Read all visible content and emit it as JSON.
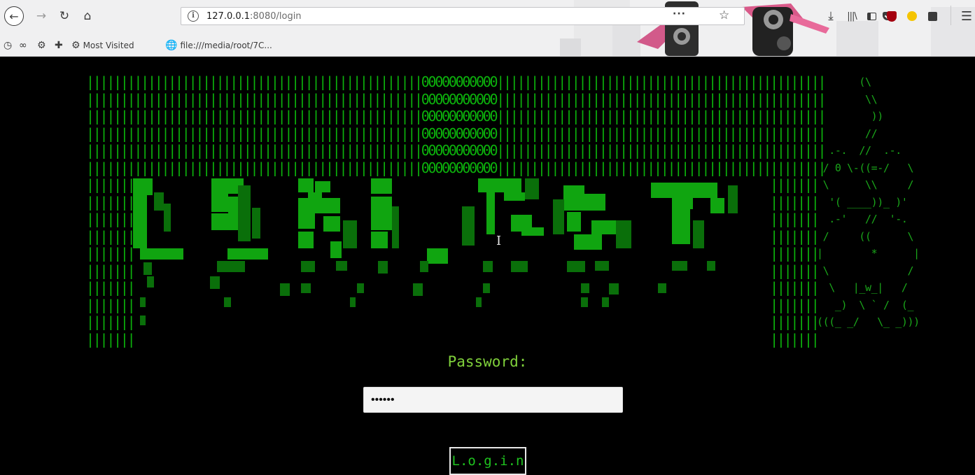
{
  "browser": {
    "url_host": "127.0.0.1",
    "url_rest": ":8080/login",
    "url_actions": "···",
    "bookmarks": [
      {
        "icon": "gear-icon",
        "label": "Most Visited"
      },
      {
        "icon": "globe-icon",
        "label": "file:///media/root/7C..."
      }
    ],
    "toolbar_icons": [
      "back-icon",
      "forward-icon",
      "reload-icon",
      "home-icon",
      "download-icon",
      "library-icon",
      "sidebar-icon",
      "ublock-icon",
      "emoji-icon",
      "note-icon",
      "menu-icon"
    ]
  },
  "page": {
    "banner_rows": [
      "|||||||||||||||||||||||||||||||||||||||||||||||||00000000000||||||||||||||||||||||||||||||||||||||||||||||||",
      "|||||||||||||||||||||||||||||||||||||||||||||||||00000000000||||||||||||||||||||||||||||||||||||||||||||||||",
      "|||||||||||||||||||||||||||||||||||||||||||||||||00000000000||||||||||||||||||||||||||||||||||||||||||||||||",
      "|||||||||||||||||||||||||||||||||||||||||||||||||00000000000||||||||||||||||||||||||||||||||||||||||||||||||",
      "|||||||||||||||||||||||||||||||||||||||||||||||||00000000000||||||||||||||||||||||||||||||||||||||||||||||||",
      "|||||||||||||||||||||||||||||||||||||||||||||||||00000000000||||||||||||||||||||||||||||||||||||||||||||||||",
      "|||||||                                                                                             |||||||",
      "|||||||                                                                                             |||||||",
      "|||||||                                                                                             |||||||",
      "|||||||                                                                                             |||||||",
      "|||||||                                                                                             |||||||",
      "|||||||                                                                                             |||||||",
      "|||||||                                                                                             |||||||",
      "|||||||                                                                                             |||||||",
      "|||||||                                                                                             |||||||",
      "|||||||                                                                                             |||||||"
    ],
    "raccoon_art": [
      "       (\\",
      "        \\\\",
      "         ))",
      "        //",
      "  .-.  //  .-.",
      " / 0 \\-((=-/   \\",
      " \\      \\\\     /",
      "  '( ____))_ )'",
      "  .-'   //  '-.",
      " /     ((      \\",
      "|        *      |",
      " \\             /",
      "  \\   |_w_|   /",
      "   _)  \\ ` /  (_",
      "(((_ _/   \\_ _)))"
    ],
    "password_label": "Password:",
    "password_value": "••••••",
    "login_label": "L.o.g.i.n"
  },
  "colors": {
    "art_green": "#0cb20c",
    "label_green": "#7fd03b",
    "background": "#000000"
  }
}
